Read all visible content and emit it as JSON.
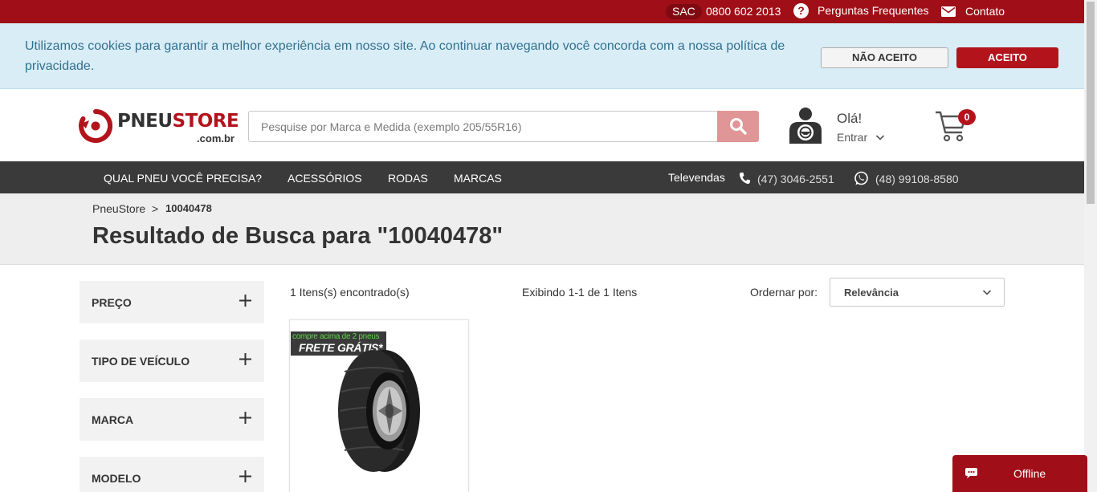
{
  "topbar": {
    "sac_label": "SAC",
    "sac_phone": "0800 602 2013",
    "faq_label": "Perguntas Frequentes",
    "contact_label": "Contato"
  },
  "cookie_notice": {
    "text": "Utilizamos cookies para garantir a melhor experiência em nosso site. Ao continuar navegando você concorda com a nossa política de privacidade.",
    "decline_label": "NÃO ACEITO",
    "accept_label": "ACEITO"
  },
  "header": {
    "logo_word_dark": "PNEU",
    "logo_word_red": "STORE",
    "logo_domain": ".com.br",
    "search_placeholder": "Pesquise por Marca e Medida (exemplo 205/55R16)",
    "greeting": "Olá!",
    "login_label": "Entrar",
    "cart_count": "0"
  },
  "nav": {
    "items": [
      "QUAL PNEU VOCÊ PRECISA?",
      "ACESSÓRIOS",
      "RODAS",
      "MARCAS"
    ],
    "televendas_label": "Televendas",
    "phone": "(47) 3046-2551",
    "whatsapp": "(48) 99108-8580"
  },
  "breadcrumb": {
    "home": "PneuStore",
    "separator": ">",
    "current": "10040478"
  },
  "results_title": {
    "bold": "Resultado",
    "rest": " de Busca para \"10040478\""
  },
  "filters": [
    "PREÇO",
    "TIPO DE VEÍCULO",
    "MARCA",
    "MODELO"
  ],
  "results_bar": {
    "found": "1 Itens(s) encontrado(s)",
    "showing": "Exibindo 1-1 de 1 Itens",
    "sort_label": "Ordernar por:",
    "sort_value": "Relevância"
  },
  "product_card": {
    "promo_top": "compre acima de 2 pneus",
    "promo_bottom": "FRETE GRÁTIS*"
  },
  "chat": {
    "status": "Offline"
  },
  "colors": {
    "brand_red": "#a00f17",
    "nav_dark": "#3a3a3a",
    "cookie_bg": "#d9edf7",
    "search_button": "#e09597"
  }
}
